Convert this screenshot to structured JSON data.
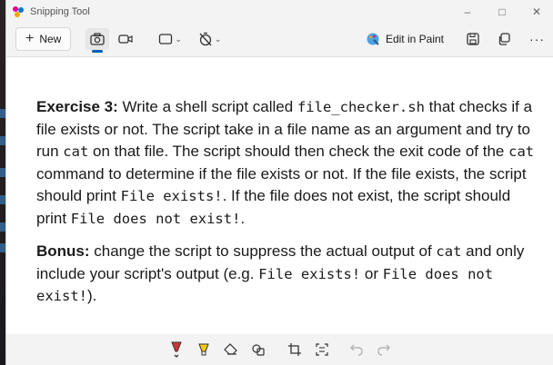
{
  "app": {
    "title": "Snipping Tool"
  },
  "window_controls": {
    "minimize": "–",
    "maximize": "□",
    "close": "✕"
  },
  "toolbar": {
    "new_label": "New",
    "edit_in_paint_label": "Edit in Paint",
    "more_label": "···"
  },
  "exercise": {
    "heading": "Exercise 3:",
    "t1": " Write a shell script called ",
    "c1": "file_checker.sh",
    "t2": " that checks if a file exists or not. The script take in a file name as an argument and try to run ",
    "c2": "cat",
    "t3": " on that file. The script should then check the exit code of the ",
    "c3": "cat",
    "t4": " command to determine if the file exists or not. If the file exists, the script should print ",
    "c4": "File exists!",
    "t5": ". If the file does not exist, the script should print ",
    "c5": "File does not exist!",
    "t6": "."
  },
  "bonus": {
    "heading": "Bonus:",
    "t1": " change the script to suppress the actual output of ",
    "c1": "cat",
    "t2": " and only include your script's output (e.g. ",
    "c2": "File exists!",
    "t3": " or ",
    "c3": "File does not exist!",
    "t4": ")."
  },
  "colors": {
    "accent": "#005fb8",
    "pen_red": "#d13438",
    "highlighter": "#f2c811"
  }
}
